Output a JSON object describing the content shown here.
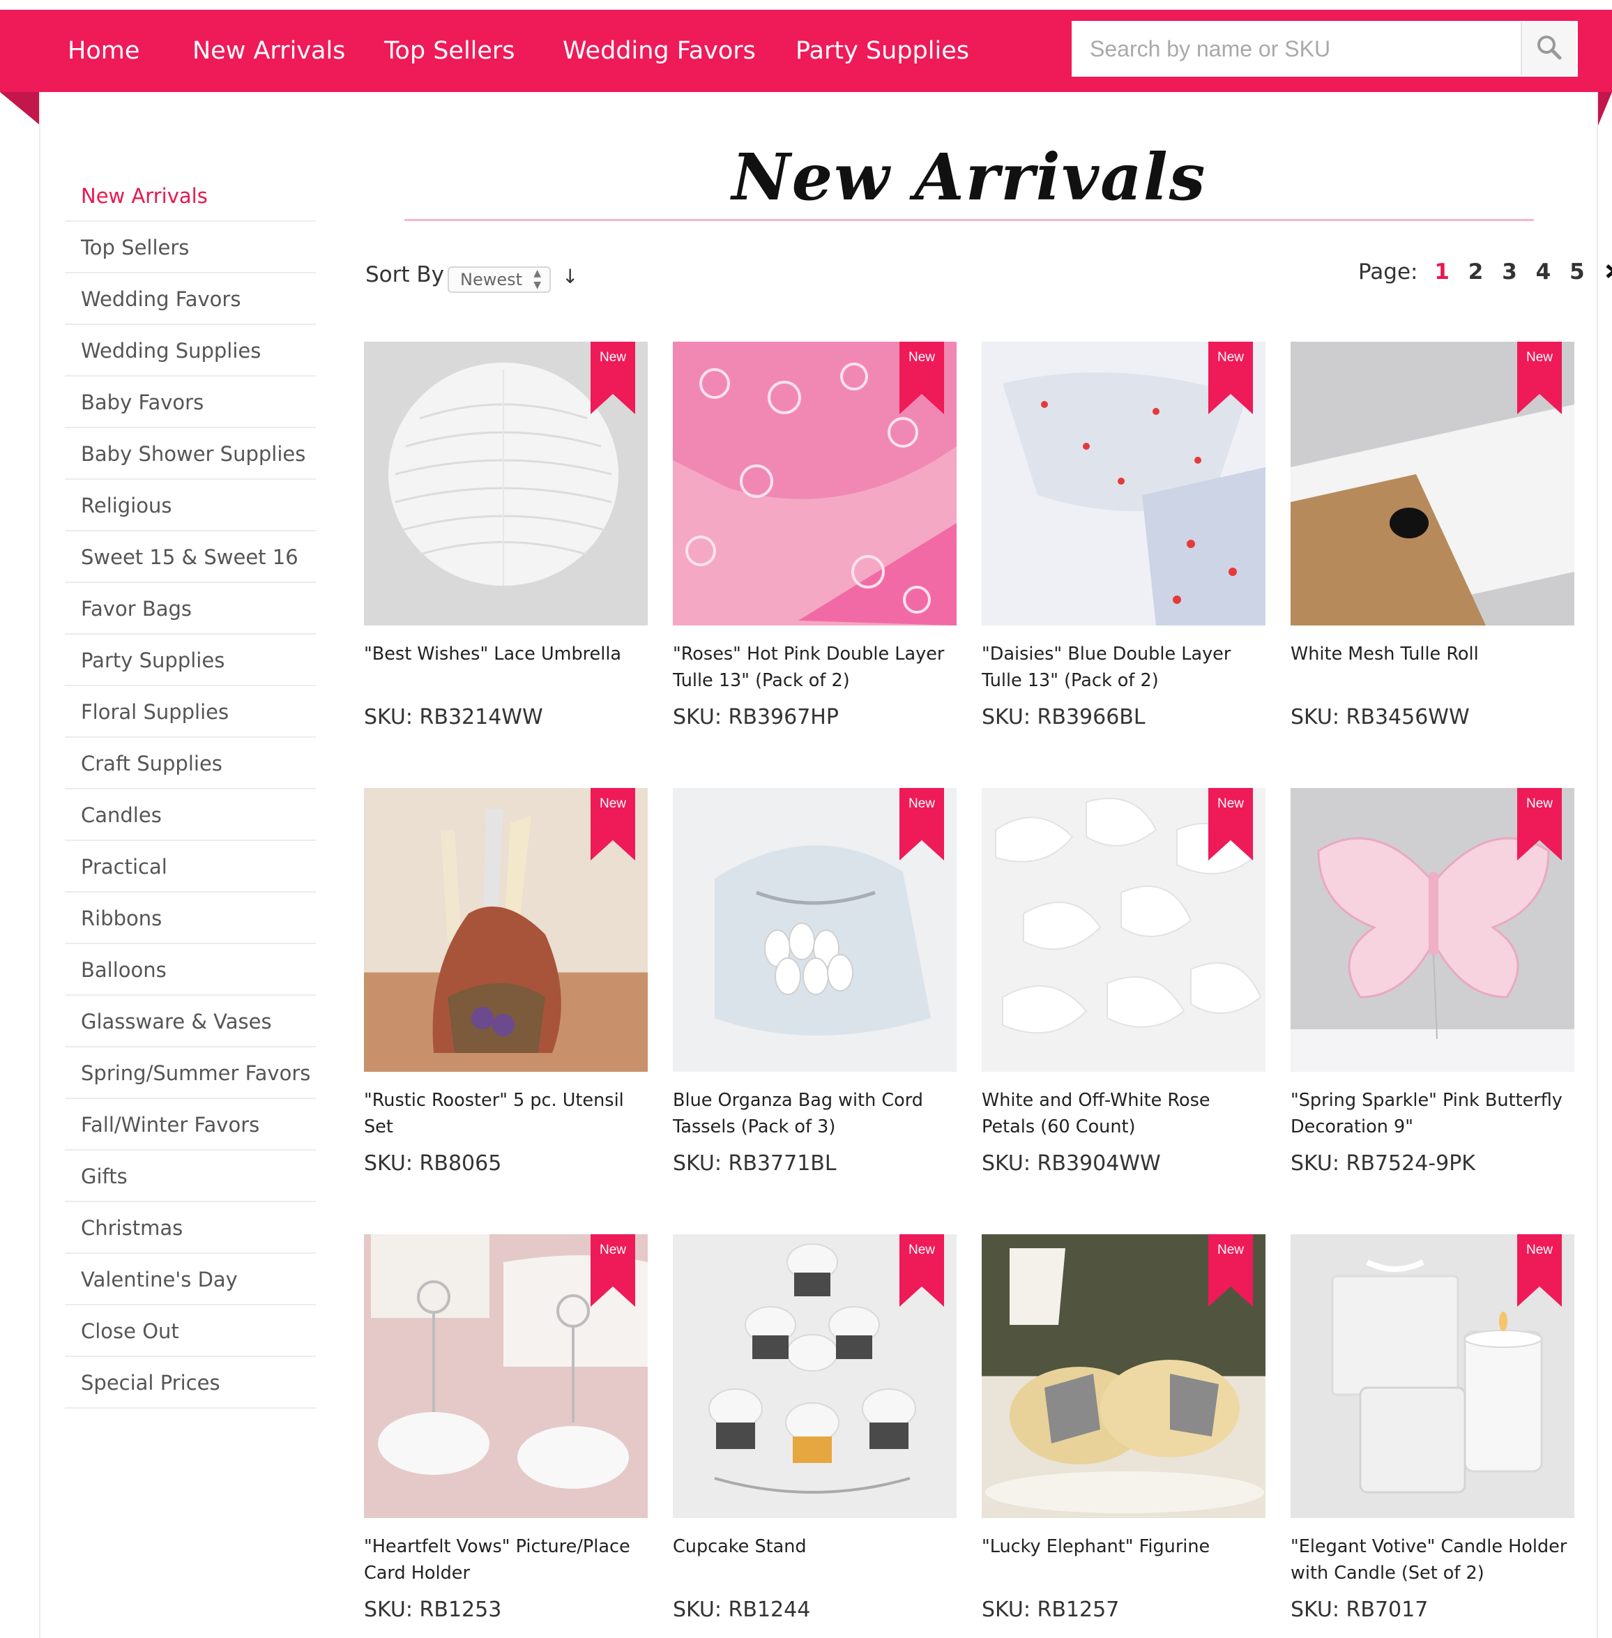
{
  "nav": {
    "items": [
      "Home",
      "New Arrivals",
      "Top Sellers",
      "Wedding Favors",
      "Party Supplies"
    ],
    "search_placeholder": "Search by name or SKU",
    "search_icon": "search-icon"
  },
  "colors": {
    "brand": "#ef1a58",
    "accent_text": "#e8194f",
    "rule": "#f6b6c8"
  },
  "sidebar": {
    "items": [
      "New Arrivals",
      "Top Sellers",
      "Wedding Favors",
      "Wedding Supplies",
      "Baby Favors",
      "Baby Shower Supplies",
      "Religious",
      "Sweet 15 & Sweet 16",
      "Favor Bags",
      "Party Supplies",
      "Floral Supplies",
      "Craft Supplies",
      "Candles",
      "Practical",
      "Ribbons",
      "Balloons",
      "Glassware & Vases",
      "Spring/Summer Favors",
      "Fall/Winter Favors",
      "Gifts",
      "Christmas",
      "Valentine's Day",
      "Close Out",
      "Special Prices"
    ],
    "active": "New Arrivals"
  },
  "main": {
    "title": "New Arrivals",
    "sort_label": "Sort By",
    "sort_value": "Newest",
    "sort_dir_icon": "↓",
    "pager": {
      "label": "Page:",
      "pages": [
        "1",
        "2",
        "3",
        "4",
        "5"
      ],
      "current": "1",
      "next_icon": "›"
    },
    "badge": "New",
    "products": [
      {
        "name": "\"Best Wishes\" Lace Umbrella",
        "sku": "SKU: RB3214WW"
      },
      {
        "name": "\"Roses\" Hot Pink Double Layer Tulle 13\" (Pack of 2)",
        "sku": "SKU: RB3967HP"
      },
      {
        "name": "\"Daisies\" Blue Double Layer Tulle 13\" (Pack of 2)",
        "sku": "SKU: RB3966BL"
      },
      {
        "name": "White Mesh Tulle Roll",
        "sku": "SKU: RB3456WW"
      },
      {
        "name": "\"Rustic Rooster\" 5 pc. Utensil Set",
        "sku": "SKU: RB8065"
      },
      {
        "name": "Blue Organza Bag with Cord Tassels (Pack of 3)",
        "sku": "SKU: RB3771BL"
      },
      {
        "name": "White and Off-White Rose Petals (60 Count)",
        "sku": "SKU: RB3904WW"
      },
      {
        "name": "\"Spring Sparkle\" Pink Butterfly Decoration 9\"",
        "sku": "SKU: RB7524-9PK"
      },
      {
        "name": "\"Heartfelt Vows\" Picture/Place Card Holder",
        "sku": "SKU: RB1253"
      },
      {
        "name": "Cupcake Stand",
        "sku": "SKU: RB1244"
      },
      {
        "name": "\"Lucky Elephant\" Figurine",
        "sku": "SKU: RB1257"
      },
      {
        "name": "\"Elegant Votive\" Candle Holder with Candle (Set of 2)",
        "sku": "SKU: RB7017"
      }
    ]
  }
}
